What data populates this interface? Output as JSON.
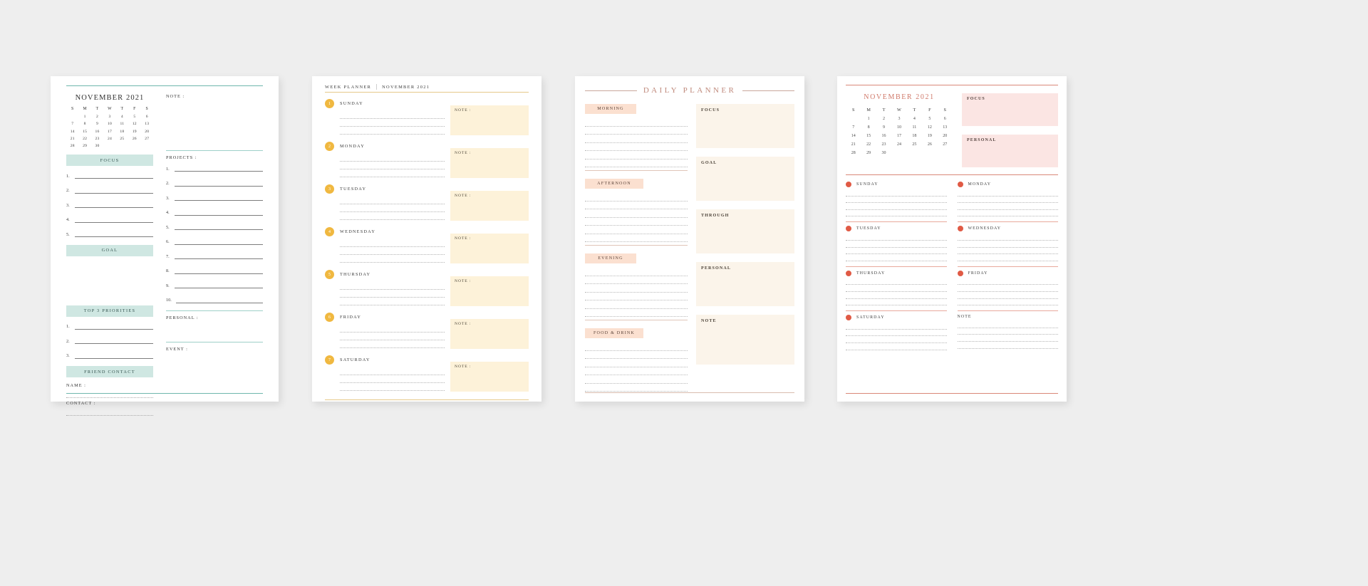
{
  "theme": {
    "page_bg": "#eeeeee",
    "teal": "#6fb7ad",
    "teal_band": "#cfe7e2",
    "yellow": "#f0b840",
    "cream_note": "#fdf2d9",
    "peach_chip": "#fbe0d0",
    "cream_box": "#fbf4ea",
    "pink_rule": "#d98878",
    "pink_box": "#fbe5e3",
    "coral_dot": "#e05a45"
  },
  "panel1": {
    "calendar": {
      "title": "NOVEMBER 2021",
      "dow": [
        "S",
        "M",
        "T",
        "W",
        "T",
        "F",
        "S"
      ],
      "weeks": [
        [
          "",
          "1",
          "2",
          "3",
          "4",
          "5",
          "6"
        ],
        [
          "7",
          "8",
          "9",
          "10",
          "11",
          "12",
          "13"
        ],
        [
          "14",
          "15",
          "16",
          "17",
          "18",
          "19",
          "20"
        ],
        [
          "21",
          "22",
          "23",
          "24",
          "25",
          "26",
          "27"
        ],
        [
          "28",
          "29",
          "30",
          "",
          "",
          "",
          ""
        ]
      ]
    },
    "focus": {
      "label": "FOCUS",
      "items": [
        "1.",
        "2.",
        "3.",
        "4.",
        "5."
      ]
    },
    "goal": {
      "label": "GOAL"
    },
    "priorities": {
      "label": "TOP 3 PRIORITIES",
      "items": [
        "1.",
        "2.",
        "3."
      ]
    },
    "friend_contact": {
      "label": "FRIEND CONTACT",
      "name_label": "NAME :",
      "contact_label": "CONTACT :"
    },
    "note": {
      "label": "NOTE :"
    },
    "projects": {
      "label": "PROJECTS :",
      "items": [
        "1.",
        "2.",
        "3.",
        "4.",
        "5.",
        "6.",
        "7.",
        "8.",
        "9.",
        "10."
      ]
    },
    "personal": {
      "label": "PERSONAL :"
    },
    "event": {
      "label": "EVENT :"
    }
  },
  "panel2": {
    "header": {
      "title": "WEEK PLANNER",
      "month": "NOVEMBER 2021"
    },
    "days": [
      {
        "num": "1",
        "name": "SUNDAY",
        "note_label": "NOTE :"
      },
      {
        "num": "2",
        "name": "MONDAY",
        "note_label": "NOTE :"
      },
      {
        "num": "3",
        "name": "TUESDAY",
        "note_label": "NOTE :"
      },
      {
        "num": "4",
        "name": "WEDNESDAY",
        "note_label": "NOTE :"
      },
      {
        "num": "5",
        "name": "THURSDAY",
        "note_label": "NOTE :"
      },
      {
        "num": "6",
        "name": "FRIDAY",
        "note_label": "NOTE :"
      },
      {
        "num": "7",
        "name": "SATURDAY",
        "note_label": "NOTE :"
      }
    ]
  },
  "panel3": {
    "title": "DAILY PLANNER",
    "time_blocks": [
      {
        "label": "MORNING"
      },
      {
        "label": "AFTERNOON"
      },
      {
        "label": "EVENING"
      },
      {
        "label": "FOOD & DRINK"
      }
    ],
    "side_blocks": [
      {
        "label": "FOCUS"
      },
      {
        "label": "GOAL"
      },
      {
        "label": "THROUGH"
      },
      {
        "label": "PERSONAL"
      },
      {
        "label": "NOTE"
      }
    ]
  },
  "panel4": {
    "calendar": {
      "title": "NOVEMBER 2021",
      "dow": [
        "S",
        "M",
        "T",
        "W",
        "T",
        "F",
        "S"
      ],
      "weeks": [
        [
          "",
          "1",
          "2",
          "3",
          "4",
          "5",
          "6"
        ],
        [
          "7",
          "8",
          "9",
          "10",
          "11",
          "12",
          "13"
        ],
        [
          "14",
          "15",
          "16",
          "17",
          "18",
          "19",
          "20"
        ],
        [
          "21",
          "22",
          "23",
          "24",
          "25",
          "26",
          "27"
        ],
        [
          "28",
          "29",
          "30",
          "",
          "",
          "",
          ""
        ]
      ]
    },
    "focus": {
      "label": "FOCUS"
    },
    "personal": {
      "label": "PERSONAL"
    },
    "days_left": [
      {
        "name": "SUNDAY",
        "dot": true
      },
      {
        "name": "TUESDAY",
        "dot": true
      },
      {
        "name": "THURSDAY",
        "dot": true
      },
      {
        "name": "SATURDAY",
        "dot": true
      }
    ],
    "days_right": [
      {
        "name": "MONDAY",
        "dot": true
      },
      {
        "name": "WEDNESDAY",
        "dot": true
      },
      {
        "name": "FRIDAY",
        "dot": true
      },
      {
        "name": "NOTE",
        "dot": false
      }
    ]
  }
}
